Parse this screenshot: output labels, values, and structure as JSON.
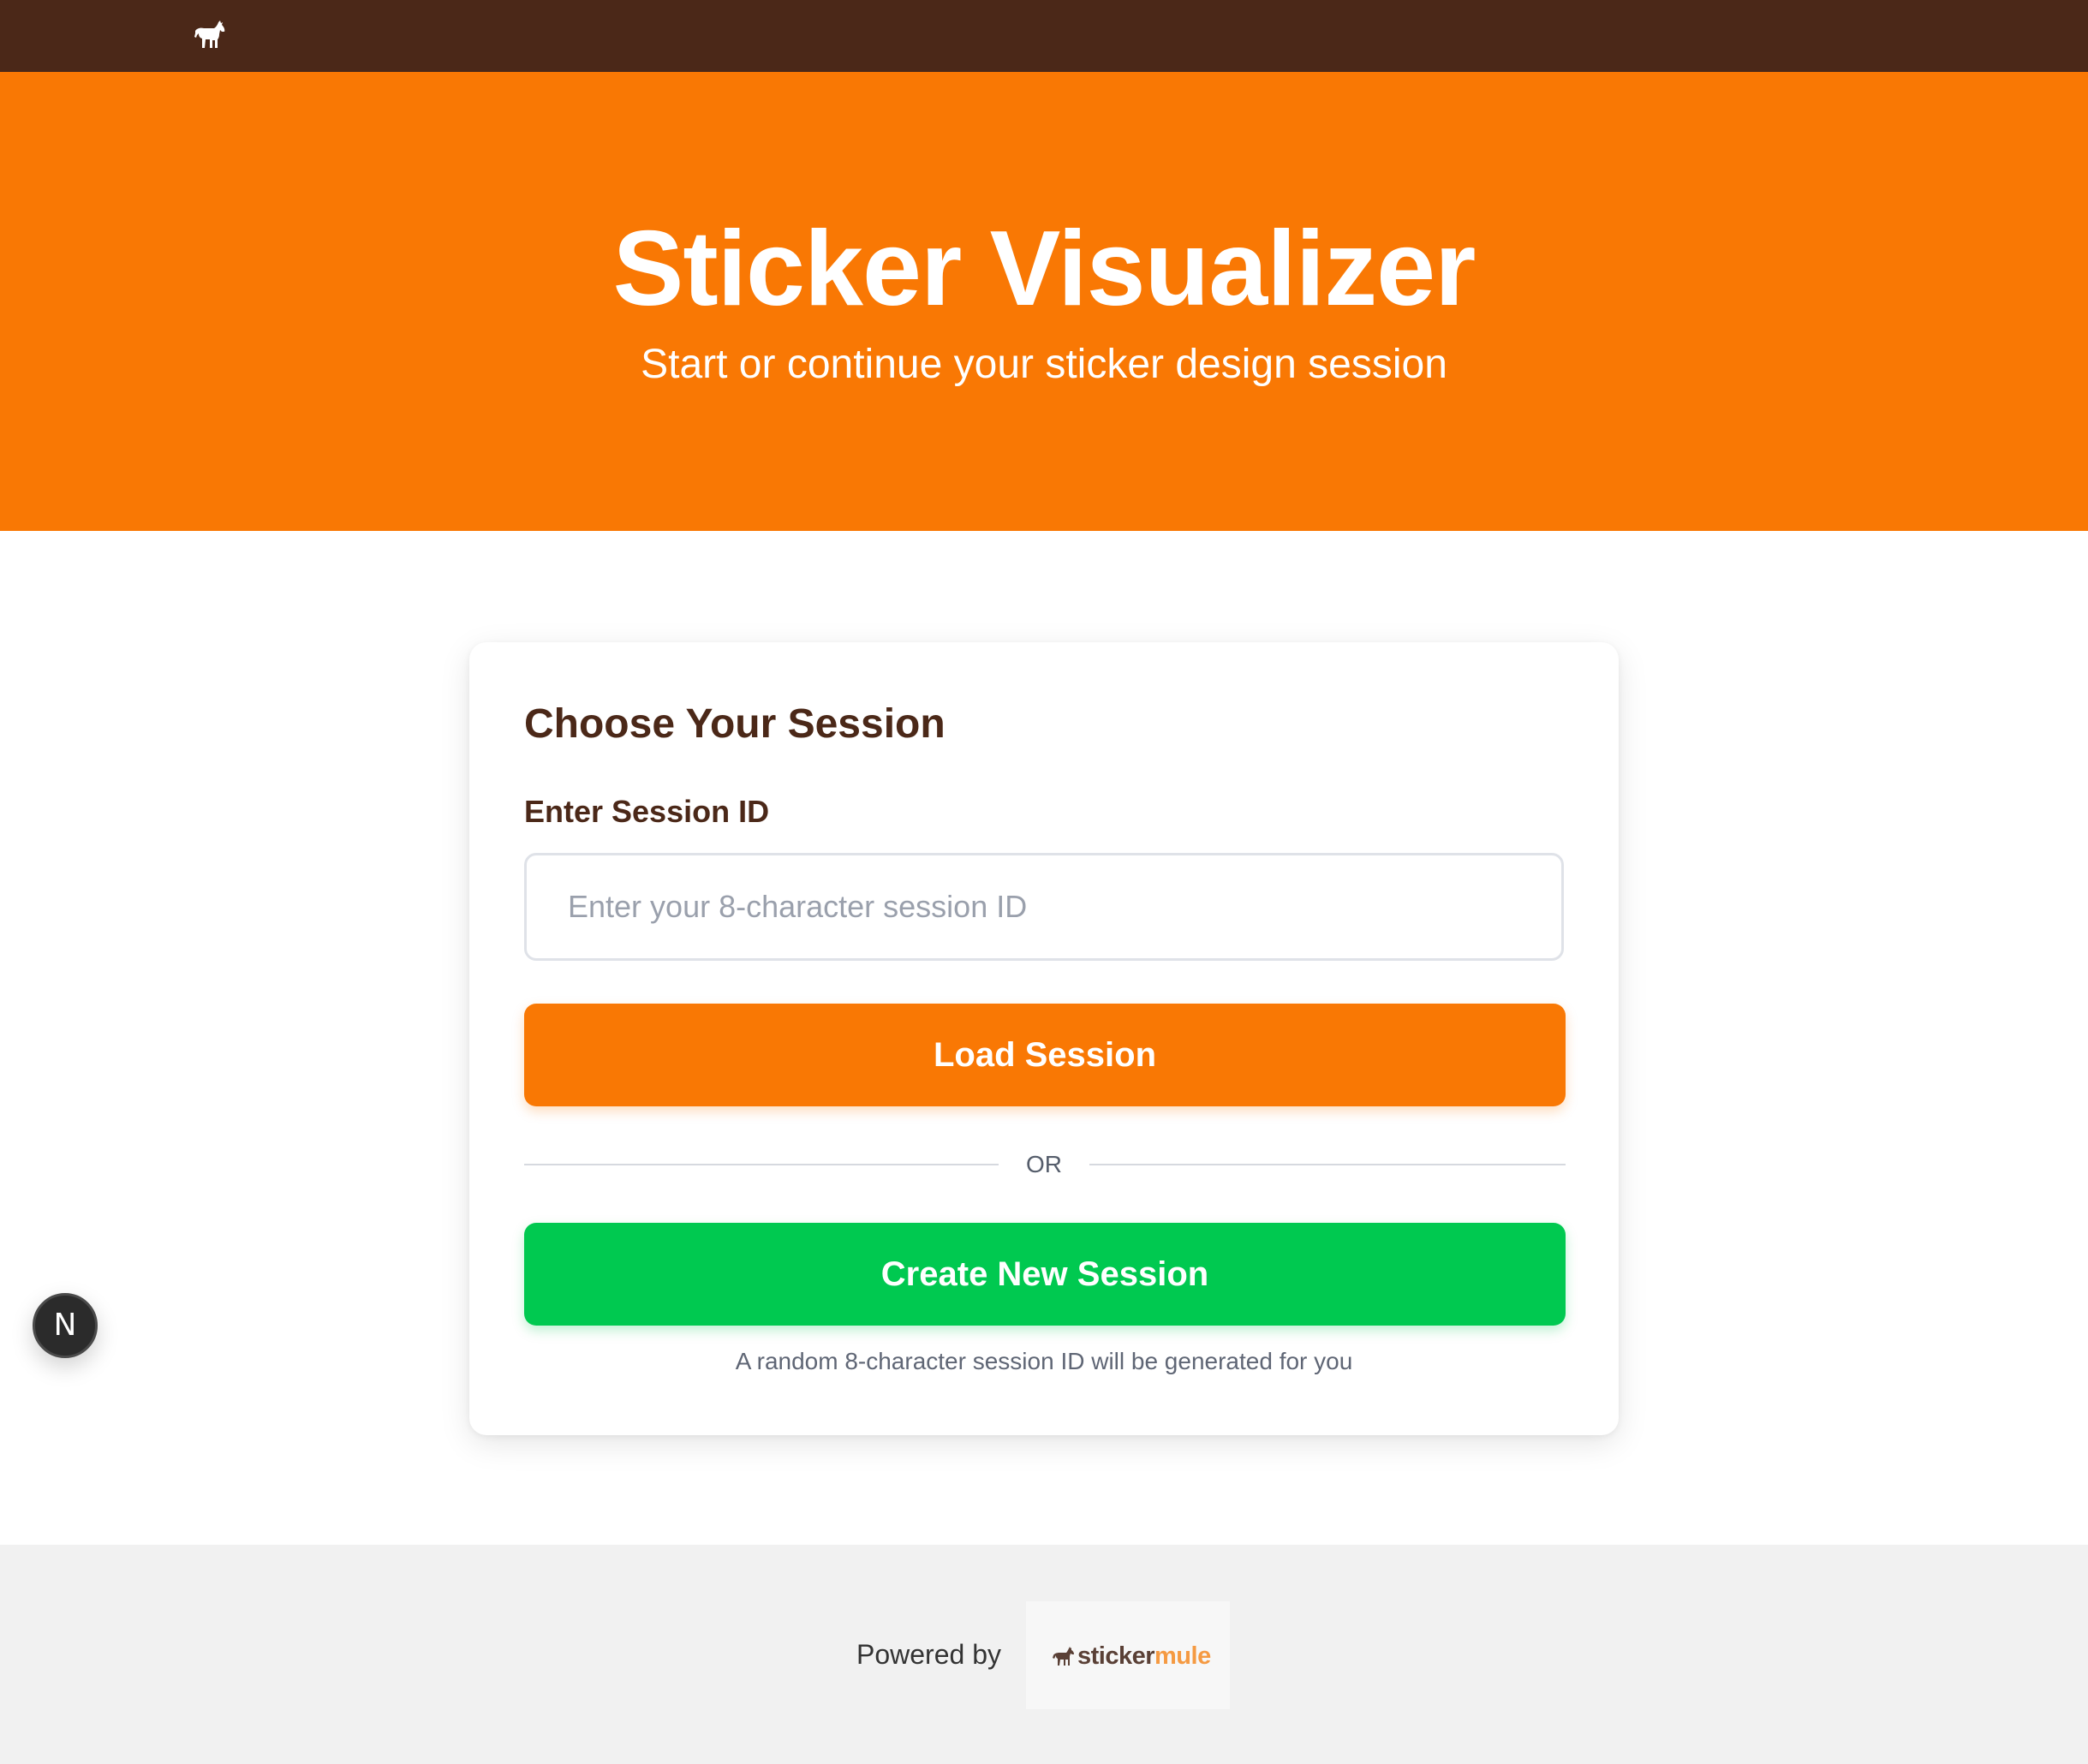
{
  "header": {
    "logo_icon": "horse-icon"
  },
  "hero": {
    "title": "Sticker Visualizer",
    "subtitle": "Start or continue your sticker design session"
  },
  "card": {
    "title": "Choose Your Session",
    "session_label": "Enter Session ID",
    "session_input": {
      "value": "",
      "placeholder": "Enter your 8-character session ID"
    },
    "load_button_label": "Load Session",
    "divider_text": "OR",
    "create_button_label": "Create New Session",
    "helper_text": "A random 8-character session ID will be generated for you"
  },
  "dev_badge": {
    "label": "N",
    "icon": "nextjs-icon"
  },
  "footer": {
    "powered_by": "Powered by",
    "brand": {
      "part1": "sticker",
      "part2": "mule",
      "icon": "mule-icon"
    }
  },
  "colors": {
    "topbar": "#4b2818",
    "accent_orange": "#f97804",
    "accent_green": "#00c950",
    "heading_brown": "#4b2818",
    "footer_bg": "#f1f1f1"
  }
}
